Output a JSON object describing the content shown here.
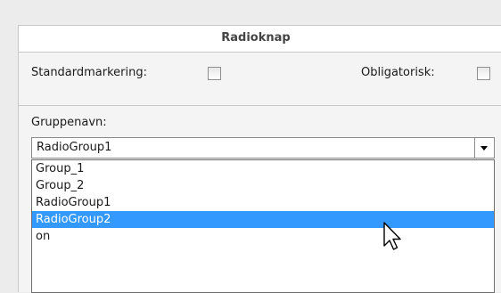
{
  "panel": {
    "title": "Radioknap",
    "default_selection_label": "Standardmarkering:",
    "required_label": "Obligatorisk:",
    "group_name_label": "Gruppenavn:"
  },
  "combo": {
    "value": "RadioGroup1",
    "options": [
      "Group_1",
      "Group_2",
      "RadioGroup1",
      "RadioGroup2",
      "on"
    ],
    "highlighted": "RadioGroup2"
  },
  "icons": {
    "arrow": "chevron-down-icon",
    "cursor": "mouse-pointer-icon"
  },
  "colors": {
    "highlight": "#3399ff"
  }
}
